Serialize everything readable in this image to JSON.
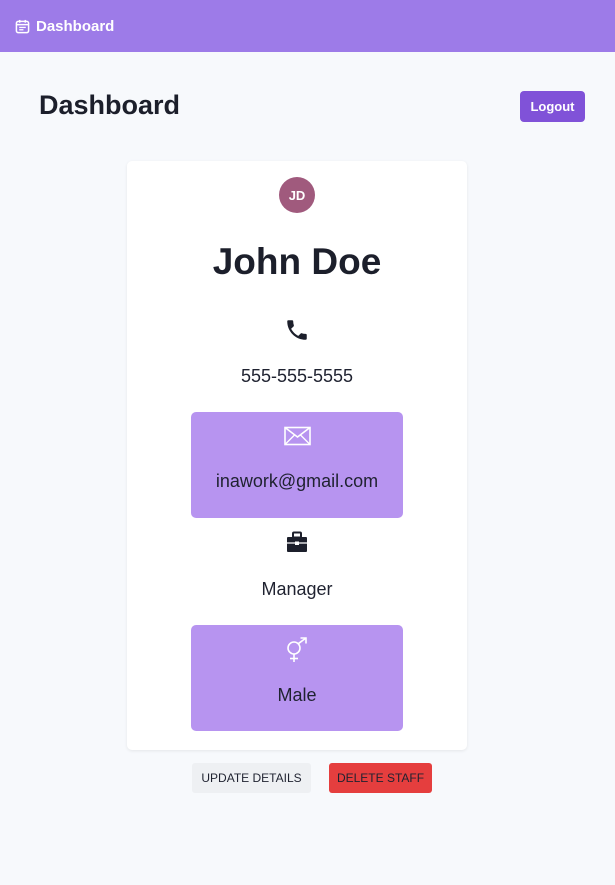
{
  "colors": {
    "topbar": "#9d7be8",
    "logout_button": "#8052d8",
    "avatar": "#a05a7d",
    "field_box": "#b794f0",
    "delete_button": "#e53e3e",
    "update_button": "#eef0f3"
  },
  "topbar": {
    "brand_icon": "calendar-icon",
    "brand_label": "Dashboard"
  },
  "header": {
    "title": "Dashboard",
    "logout_label": "Logout"
  },
  "staff": {
    "initials": "JD",
    "name": "John Doe",
    "phone_icon": "phone-icon",
    "phone": "555-555-5555",
    "email_icon": "envelope-icon",
    "email": "inawork@gmail.com",
    "role_icon": "briefcase-icon",
    "role": "Manager",
    "gender_icon": "gender-icon",
    "gender": "Male"
  },
  "actions": {
    "update_label": "UPDATE DETAILS",
    "delete_label": "DELETE STAFF"
  }
}
